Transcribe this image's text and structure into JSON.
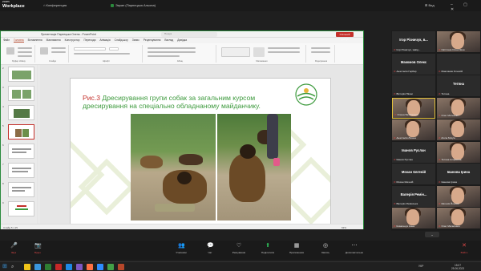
{
  "zoom": {
    "logo_top": "zoom",
    "logo_bottom": "Workplace",
    "tab_conference": "Конференция",
    "share_title": "Экран (Парпецька Альона)",
    "view_label": "Вид",
    "window_controls": "–  ▢  ✕",
    "collapse_label": "⌄"
  },
  "ppt": {
    "window_title": "Презентація Парпецька Олена - PowerPoint",
    "search_placeholder": "Пошук",
    "share_button": "Спільний доступ",
    "tabs": [
      "Файл",
      "Головна",
      "Вставлення",
      "Малювання",
      "Конструктор",
      "Переходи",
      "Анімація",
      "Слайд-шоу",
      "Запис",
      "Рецензування",
      "Вигляд",
      "Довідка"
    ],
    "active_tab_index": 1,
    "ribbon_groups": [
      "Буфер обміну",
      "Слайди",
      "Шрифт",
      "Абзац",
      "Малювання",
      "Редагування"
    ],
    "thumb_numbers": [
      "2",
      "3",
      "4",
      "5",
      "6",
      "7",
      "8",
      "9"
    ],
    "status_left": "Слайд 5 з 15",
    "status_right": "63%"
  },
  "slide": {
    "title_prefix": "Рис.3",
    "title_text": " Дресирування групи собак за загальним курсом дресирування на спеціально обладнаному майданчику."
  },
  "participants": [
    {
      "type": "text",
      "big": "Ігор Різничук, в...",
      "sub": "Ігор Різничук, завід..."
    },
    {
      "type": "video",
      "sub": "Світлана Олексіївна"
    },
    {
      "type": "text",
      "big": "Макомов Олекс",
      "sub": "Анастасія Гарбар"
    },
    {
      "type": "text",
      "big": "",
      "sub": "Максимов Олексій"
    },
    {
      "type": "text",
      "big": "",
      "sub": "Вікторія Ніком"
    },
    {
      "type": "text",
      "big": "Тетяна",
      "sub": "Тетяна"
    },
    {
      "type": "video",
      "sub": "Олена Батьтигина",
      "hl": true
    },
    {
      "type": "video",
      "sub": "Олег Митькевіч"
    },
    {
      "type": "video",
      "sub": "Анастасія Лісина"
    },
    {
      "type": "video",
      "sub": "Alona Moiyw"
    },
    {
      "type": "text",
      "big": "Іванов Руслан",
      "sub": "Іванов Руслан"
    },
    {
      "type": "video",
      "sub": "Тетяна Алфімова"
    },
    {
      "type": "text",
      "big": "Мохан Євгеній",
      "sub": "Мохан Євгеній"
    },
    {
      "type": "text",
      "big": "Іванова Ірина",
      "sub": "Іванова Ірина"
    },
    {
      "type": "text",
      "big": "Валерія Ремін...",
      "sub": "Валерія Ремінська"
    },
    {
      "type": "video",
      "sub": "Євгенія Йонова"
    },
    {
      "type": "video",
      "sub": "Ковальчук Анна"
    },
    {
      "type": "video",
      "sub": "Олег Мигалевич"
    }
  ],
  "controls": [
    {
      "label": "Звук",
      "icon": "🎤",
      "color": "red"
    },
    {
      "label": "Відео",
      "icon": "📷",
      "color": "red"
    },
    {
      "label": "Учасники",
      "icon": "👥",
      "color": "normal"
    },
    {
      "label": "Чат",
      "icon": "💬",
      "color": "normal"
    },
    {
      "label": "Реагування",
      "icon": "♡",
      "color": "normal"
    },
    {
      "label": "Поділитися",
      "icon": "⬆",
      "color": "green"
    },
    {
      "label": "Приложения",
      "icon": "▦",
      "color": "normal"
    },
    {
      "label": "Запись",
      "icon": "◎",
      "color": "normal"
    },
    {
      "label": "Дополнительно",
      "icon": "⋯",
      "color": "normal"
    },
    {
      "label": "Вийти",
      "icon": "✕",
      "color": "red"
    }
  ],
  "taskbar": {
    "lang": "УКР",
    "time": "15:07",
    "date": "25.06.2023",
    "icon_colors": [
      "#f0c419",
      "#3a96dd",
      "#2e7d32",
      "#c62828",
      "#1e88e5",
      "#7e57c2",
      "#ff7043",
      "#2d8cff",
      "#43a047",
      "#b7472a"
    ]
  }
}
